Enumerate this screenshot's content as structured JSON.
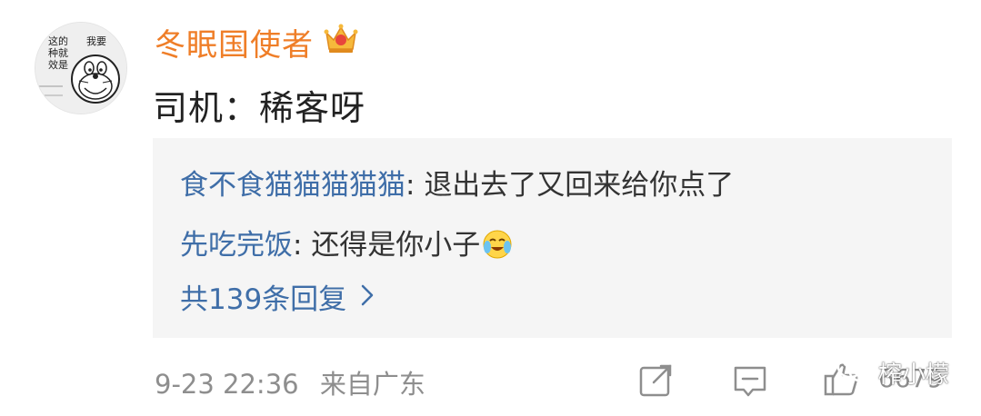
{
  "post": {
    "username": "冬眠国使者",
    "avatar_text": [
      "这的",
      "种就",
      "效是",
      "我要"
    ],
    "text": "司机：稀客呀"
  },
  "replies": [
    {
      "author": "食不食猫猫猫猫猫",
      "sep": ": ",
      "text": "退出去了又回来给你点了"
    },
    {
      "author": "先吃完饭",
      "sep": ": ",
      "text": "还得是你小子",
      "emoji": "cry-laugh-emoji"
    }
  ],
  "more_replies_label": "共139条回复",
  "meta": {
    "time": "9-23 22:36",
    "source": "来自广东"
  },
  "actions": {
    "like_count": "6679"
  },
  "watermark": "榨小檬",
  "colors": {
    "username": "#ef7e28",
    "reply_author": "#3f6ea8",
    "meta": "#8e8e8e",
    "reply_bg": "#f5f5f5"
  },
  "icons": [
    "crown-badge-icon",
    "chevron-right-icon",
    "repost-icon",
    "comment-icon",
    "like-icon",
    "wechat-icon"
  ]
}
